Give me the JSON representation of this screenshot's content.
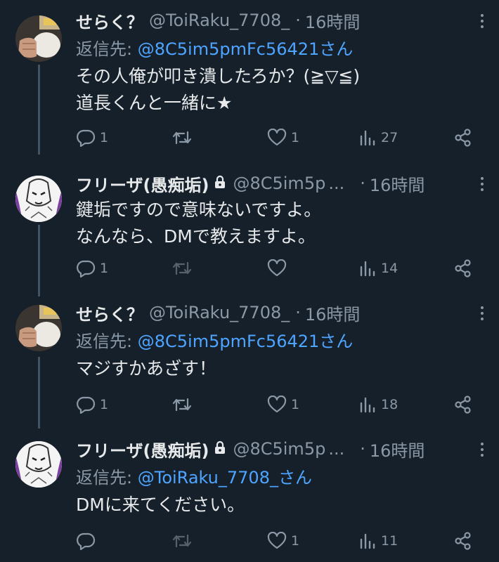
{
  "tweets": [
    {
      "name": "せらく？",
      "handle": "@ToiRaku_7708_",
      "time": "16時間",
      "replying_label": "返信先:",
      "replying_to": "@8C5im5pmFc56421さん",
      "lines": [
        "その人俺が叩き潰したろか？(≧▽≦)",
        "道長くんと一緒に★"
      ],
      "replies": "1",
      "retweets": "",
      "likes": "1",
      "views": "27",
      "avatar": "hand-photo",
      "locked": false
    },
    {
      "name": "フリーザ(愚痴垢)",
      "handle": "@8C5im5p",
      "handle_ellipsis": "...",
      "time": "16時間",
      "lines": [
        "鍵垢ですので意味ないですよ。",
        "なんなら、DMで教えますよ。"
      ],
      "replies": "1",
      "retweets": "",
      "likes": "",
      "views": "14",
      "avatar": "frieza-drawing",
      "locked": true
    },
    {
      "name": "せらく？",
      "handle": "@ToiRaku_7708_",
      "time": "16時間",
      "replying_label": "返信先:",
      "replying_to": "@8C5im5pmFc56421さん",
      "lines": [
        "マジすかあざす！"
      ],
      "replies": "1",
      "retweets": "",
      "likes": "1",
      "views": "18",
      "avatar": "hand-photo",
      "locked": false
    },
    {
      "name": "フリーザ(愚痴垢)",
      "handle": "@8C5im5p",
      "handle_ellipsis": "...",
      "time": "16時間",
      "replying_label": "返信先:",
      "replying_to": "@ToiRaku_7708_さん",
      "lines": [
        "DMに来てください。"
      ],
      "replies": "",
      "retweets": "",
      "likes": "1",
      "views": "11",
      "avatar": "frieza-drawing",
      "locked": true
    }
  ],
  "colors": {
    "background": "#15202b",
    "text": "#e7e9ea",
    "muted": "#8b98a5",
    "link": "#4ea5ff",
    "thread_line": "#425364"
  },
  "icons": {
    "reply": "reply-bubble-icon",
    "retweet": "retweet-arrows-icon",
    "like": "heart-icon",
    "views": "bar-chart-icon",
    "share": "share-icon",
    "lock": "lock-icon",
    "more": "more-dots-icon"
  }
}
